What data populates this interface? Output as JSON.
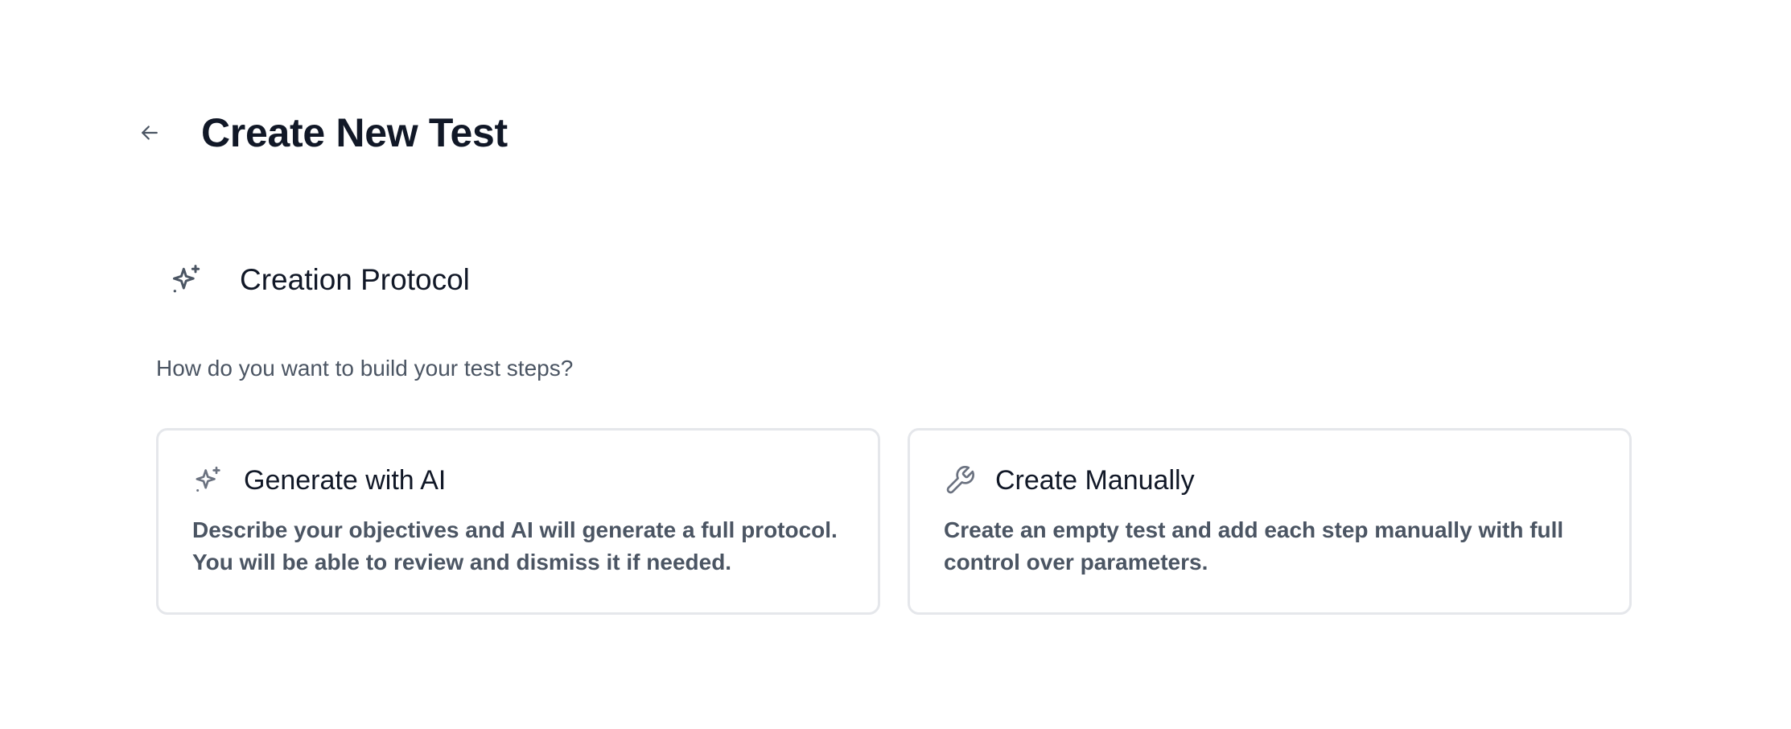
{
  "header": {
    "back_icon": "arrow-left-icon",
    "title": "Create New Test"
  },
  "section": {
    "icon": "sparkles-icon",
    "title": "Creation Protocol",
    "subtitle": "How do you want to build your test steps?"
  },
  "options": [
    {
      "icon": "sparkles-icon",
      "title": "Generate with AI",
      "description": "Describe your objectives and AI will generate a full protocol. You will be able to review and dismiss it if needed."
    },
    {
      "icon": "wrench-icon",
      "title": "Create Manually",
      "description": "Create an empty test and add each step manually with full control over parameters."
    }
  ],
  "colors": {
    "text_primary": "#111827",
    "text_secondary": "#4b5563",
    "border": "#e5e7eb",
    "icon": "#6b7280"
  }
}
